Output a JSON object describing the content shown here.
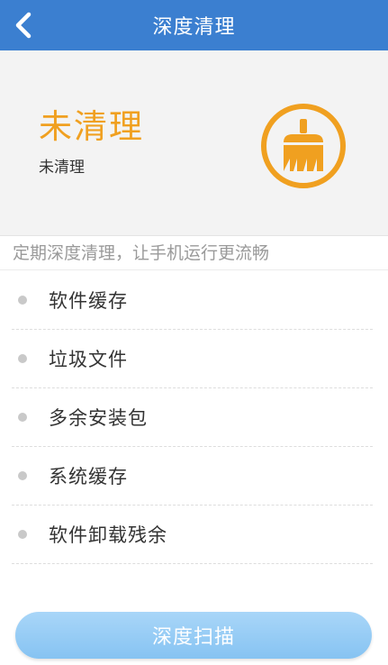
{
  "header": {
    "title": "深度清理",
    "back_icon": "chevron-left-icon",
    "color": "#3b7fd0"
  },
  "status": {
    "title": "未清理",
    "subtitle": "未清理",
    "badge_icon": "broom-icon",
    "accent_color": "#f0a020"
  },
  "tip": "定期深度清理，让手机运行更流畅",
  "items": [
    {
      "label": "软件缓存"
    },
    {
      "label": "垃圾文件"
    },
    {
      "label": "多余安装包"
    },
    {
      "label": "系统缓存"
    },
    {
      "label": "软件卸载残余"
    }
  ],
  "scan_button": {
    "label": "深度扫描",
    "color": "#86c3f2"
  }
}
